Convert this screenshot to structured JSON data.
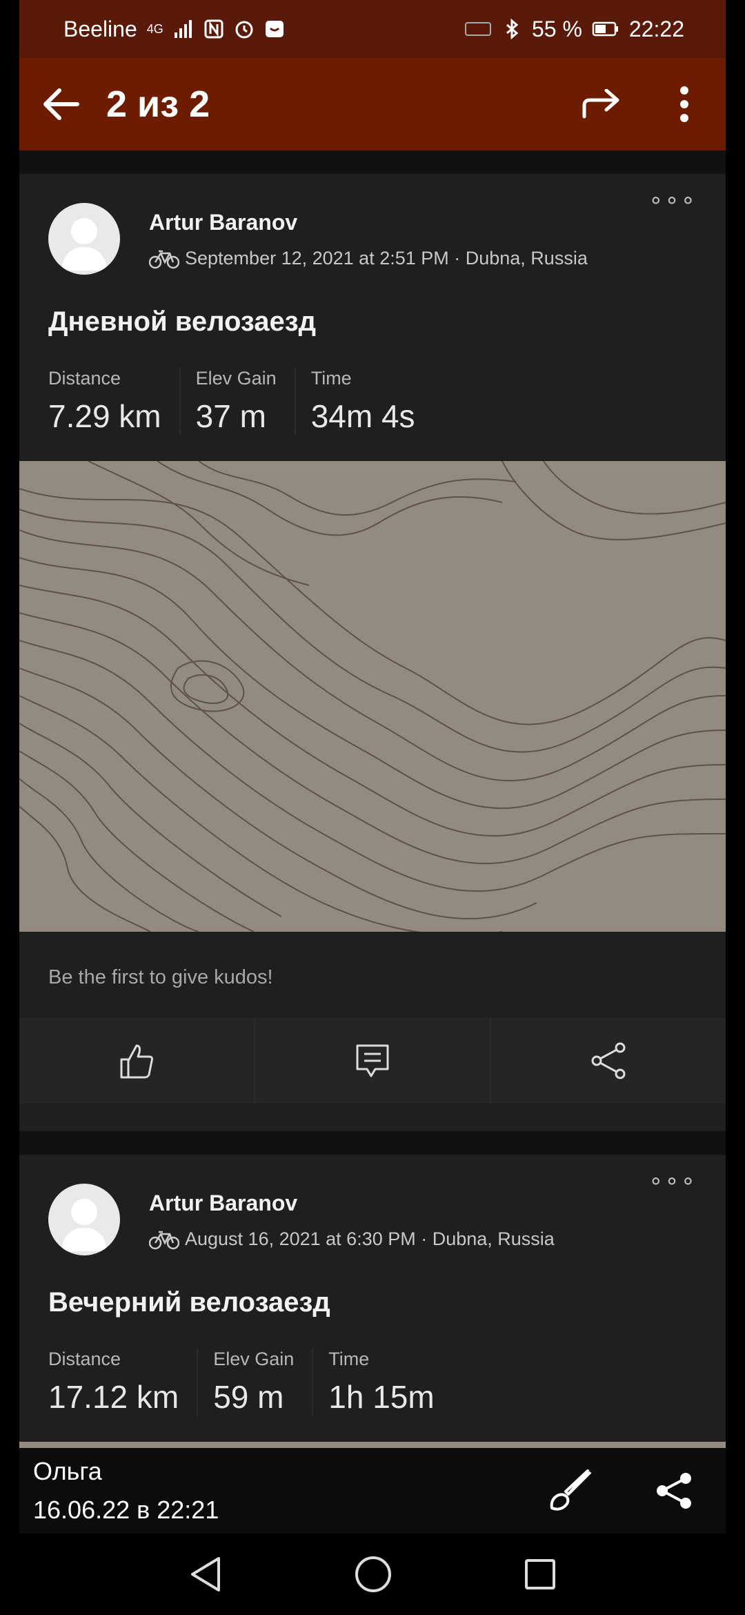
{
  "status_bar": {
    "carrier": "Beeline",
    "network": "4G",
    "battery": "55 %",
    "time": "22:22"
  },
  "toolbar": {
    "title": "2 из 2",
    "icons": [
      "back-arrow-icon",
      "forward-share-icon",
      "overflow-menu-icon"
    ]
  },
  "cards": [
    {
      "athlete": "Artur Baranov",
      "meta": "September 12, 2021 at 2:51 PM · Dubna, Russia",
      "activity_icon": "bike-icon",
      "title": "Дневной велозаезд",
      "stats": [
        {
          "label": "Distance",
          "value": "7.29 km"
        },
        {
          "label": "Elev Gain",
          "value": "37 m"
        },
        {
          "label": "Time",
          "value": "34m 4s"
        }
      ],
      "kudos_text": "Be the first to give kudos!",
      "more": "∘∘∘"
    },
    {
      "athlete": "Artur Baranov",
      "meta": "August 16, 2021 at 6:30 PM · Dubna, Russia",
      "activity_icon": "bike-icon",
      "title": "Вечерний велозаезд",
      "stats": [
        {
          "label": "Distance",
          "value": "17.12 km"
        },
        {
          "label": "Elev Gain",
          "value": "59 m"
        },
        {
          "label": "Time",
          "value": "1h 15m"
        }
      ],
      "more": "∘∘∘"
    }
  ],
  "viewer": {
    "sender": "Ольга",
    "date": "16.06.22 в 22:21"
  },
  "colors": {
    "toolbar": "#6e1c00",
    "status_bar": "#5a1a0a",
    "card": "#1f1f20",
    "map": "#948b80"
  }
}
